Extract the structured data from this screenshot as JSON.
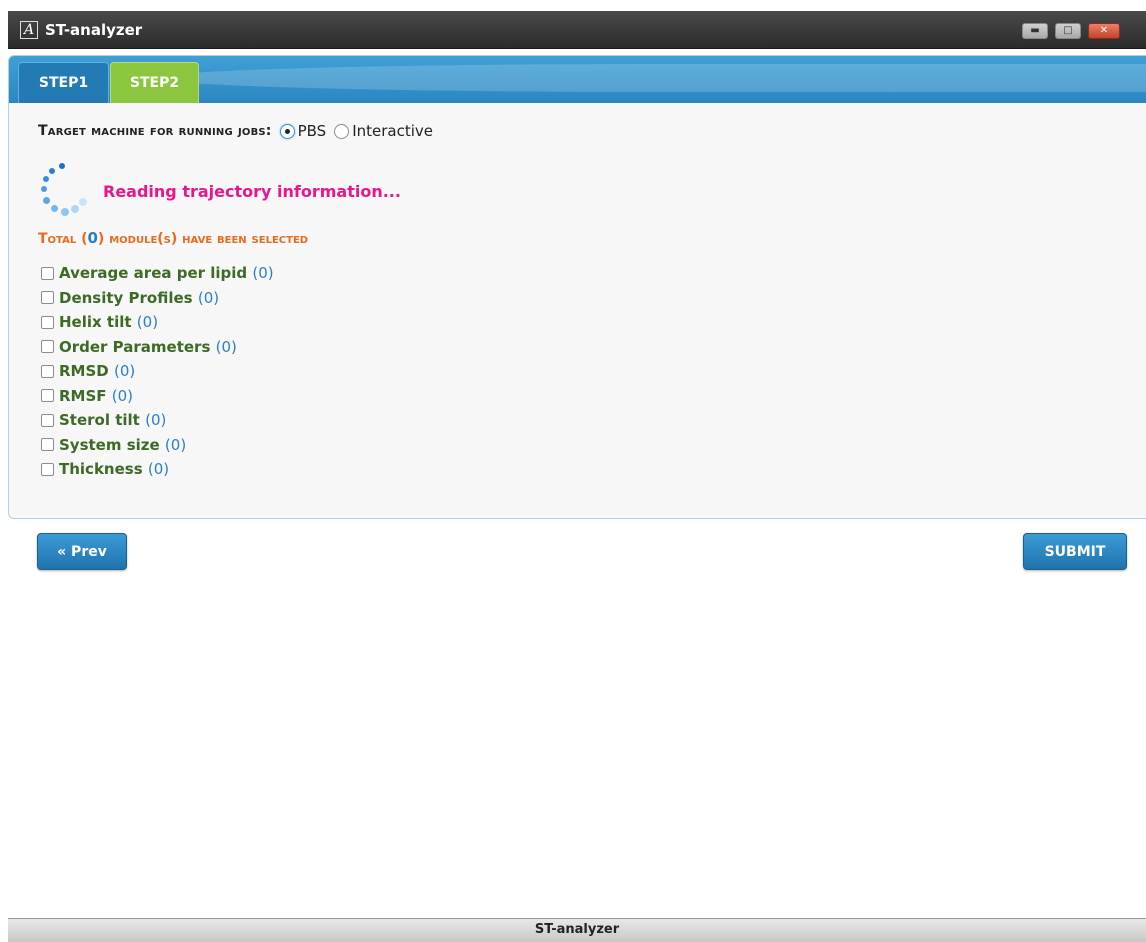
{
  "window": {
    "title": "ST-analyzer",
    "app_icon": "app-logo-icon",
    "controls": {
      "minimize": "minimize-icon",
      "maximize": "maximize-icon",
      "close": "close-icon"
    },
    "close_color": "#c6432a"
  },
  "tabs": [
    {
      "label": "STEP1",
      "color": "#247bb3"
    },
    {
      "label": "STEP2",
      "color": "#8cc63e",
      "active": true
    }
  ],
  "target": {
    "label": "Target machine for running jobs:",
    "options": [
      {
        "label": "PBS",
        "selected": true
      },
      {
        "label": "Interactive",
        "selected": false
      }
    ]
  },
  "status": {
    "loading_text": "Reading trajectory information...",
    "loading_color": "#e8168c",
    "spinner_icon": "loading-spinner-icon"
  },
  "summary": {
    "prefix": "Total (",
    "count": "0",
    "suffix": ") module(s) have been selected",
    "color": "#e86a1c"
  },
  "modules": [
    {
      "label": "Average area per lipid",
      "count": "0",
      "checked": false
    },
    {
      "label": "Density Profiles",
      "count": "0",
      "checked": false
    },
    {
      "label": "Helix tilt",
      "count": "0",
      "checked": false
    },
    {
      "label": "Order Parameters",
      "count": "0",
      "checked": false
    },
    {
      "label": "RMSD",
      "count": "0",
      "checked": false
    },
    {
      "label": "RMSF",
      "count": "0",
      "checked": false
    },
    {
      "label": "Sterol tilt",
      "count": "0",
      "checked": false
    },
    {
      "label": "System size",
      "count": "0",
      "checked": false
    },
    {
      "label": "Thickness",
      "count": "0",
      "checked": false
    }
  ],
  "buttons": {
    "prev_label": "« Prev",
    "submit_label": "SUBMIT",
    "color": "#1f73ad"
  },
  "statusbar": {
    "text": "ST-analyzer"
  }
}
